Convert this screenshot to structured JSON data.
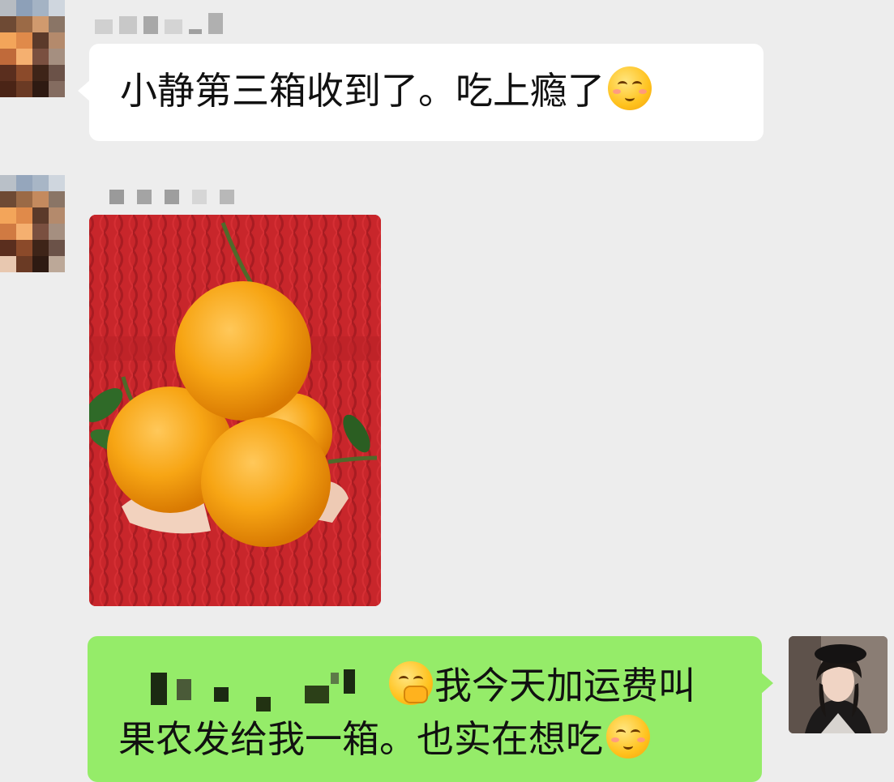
{
  "chat": {
    "messages": [
      {
        "sender_side": "left",
        "type": "text",
        "text": "小静第三箱收到了。吃上瘾了",
        "emoji": "blush-smile-emoji"
      },
      {
        "sender_side": "left",
        "type": "image",
        "image_description_icon": "oranges-photo"
      },
      {
        "sender_side": "right",
        "type": "text",
        "line1": "我今天加运费叫",
        "line2": "果农发给我一箱。也实在想吃",
        "emoji_start": "thinking-emoji",
        "emoji_end": "blush-smile-emoji"
      }
    ]
  },
  "colors": {
    "background": "#ededed",
    "incoming_bubble": "#ffffff",
    "outgoing_bubble": "#95ec69"
  }
}
